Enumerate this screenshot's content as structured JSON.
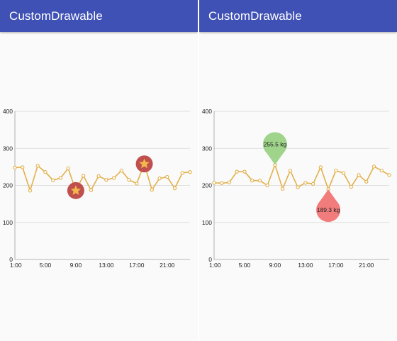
{
  "app": {
    "left_title": "CustomDrawable",
    "right_title": "CustomDrawable"
  },
  "colors": {
    "appbar": "#3f51b5",
    "line": "#e2b04a",
    "grid": "#d6d6d6",
    "star_marker": "#c0504d",
    "star": "#f2b84b",
    "bubble_high": "#9fd48a",
    "bubble_low": "#f27c7c"
  },
  "chart_data": [
    {
      "type": "line",
      "title": "",
      "xlabel": "",
      "ylabel": "",
      "ylim": [
        0,
        400
      ],
      "xlim": [
        1,
        24
      ],
      "y_ticks": [
        0,
        100,
        200,
        300,
        400
      ],
      "x_ticks": [
        1,
        5,
        9,
        13,
        17,
        21
      ],
      "x_tick_labels": [
        "1:00",
        "5:00",
        "9:00",
        "13:00",
        "17:00",
        "21:00"
      ],
      "grid": true,
      "legend": "none",
      "series": [
        {
          "x": [
            1,
            2,
            3,
            4,
            5,
            6,
            7,
            8,
            9,
            10,
            11,
            12,
            13,
            14,
            15,
            16,
            17,
            18,
            19,
            20,
            21,
            22,
            23,
            24
          ],
          "values": [
            248,
            249,
            186,
            253,
            236,
            214,
            220,
            246,
            186,
            226,
            187,
            225,
            215,
            220,
            240,
            215,
            205,
            258,
            188,
            219,
            223,
            192,
            234,
            236
          ]
        }
      ],
      "markers": [
        {
          "kind": "star",
          "x": 9,
          "y": 186
        },
        {
          "kind": "star",
          "x": 18,
          "y": 258
        }
      ]
    },
    {
      "type": "line",
      "title": "",
      "xlabel": "",
      "ylabel": "",
      "ylim": [
        0,
        400
      ],
      "xlim": [
        1,
        24
      ],
      "y_ticks": [
        0,
        100,
        200,
        300,
        400
      ],
      "x_ticks": [
        1,
        5,
        9,
        13,
        17,
        21
      ],
      "x_tick_labels": [
        "1:00",
        "5:00",
        "9:00",
        "13:00",
        "17:00",
        "21:00"
      ],
      "grid": true,
      "legend": "none",
      "series": [
        {
          "x": [
            1,
            2,
            3,
            4,
            5,
            6,
            7,
            8,
            9,
            10,
            11,
            12,
            13,
            14,
            15,
            16,
            17,
            18,
            19,
            20,
            21,
            22,
            23,
            24
          ],
          "values": [
            207,
            206,
            208,
            237,
            237,
            213,
            213,
            200,
            255.5,
            191,
            240,
            195,
            207,
            204,
            249,
            189.3,
            240,
            233,
            196,
            228,
            210,
            251,
            240,
            228
          ]
        }
      ],
      "markers": [
        {
          "kind": "bubble-above",
          "x": 9,
          "y": 255.5,
          "label": "255.5 kg"
        },
        {
          "kind": "bubble-below",
          "x": 16,
          "y": 189.3,
          "label": "189.3 kg"
        }
      ]
    }
  ]
}
